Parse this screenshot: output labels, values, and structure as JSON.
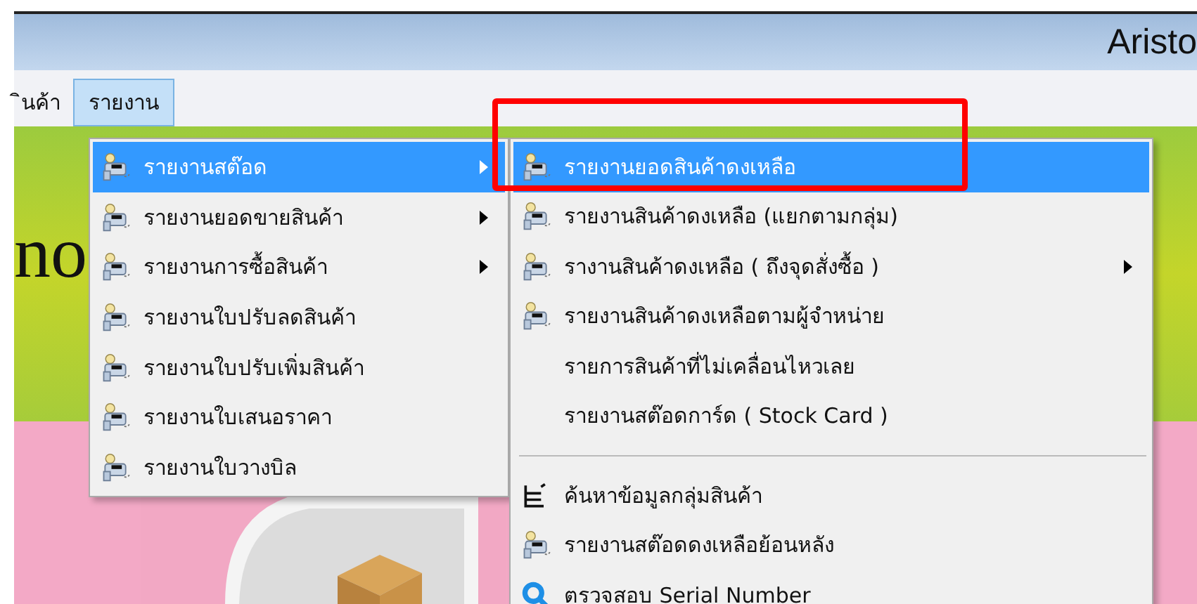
{
  "window": {
    "title": "Aristo"
  },
  "menu_bar": [
    {
      "label": "ินค้า",
      "selected": false
    },
    {
      "label": "รายงาน",
      "selected": true
    }
  ],
  "heading": "no",
  "menu": [
    {
      "kind": "report",
      "label": "รายงานสต๊อด",
      "has_submenu": true,
      "selected": true
    },
    {
      "kind": "report",
      "label": "รายงานยอดขายสินค้า",
      "has_submenu": true,
      "selected": false
    },
    {
      "kind": "report",
      "label": "รายงานการซื้อสินค้า",
      "has_submenu": true,
      "selected": false
    },
    {
      "kind": "report",
      "label": "รายงานใบปรับลดสินค้า",
      "has_submenu": false,
      "selected": false
    },
    {
      "kind": "report",
      "label": "รายงานใบปรับเพิ่มสินค้า",
      "has_submenu": false,
      "selected": false
    },
    {
      "kind": "report",
      "label": "รายงานใบเสนอราคา",
      "has_submenu": false,
      "selected": false
    },
    {
      "kind": "report",
      "label": "รายงานใบวางบิล",
      "has_submenu": false,
      "selected": false
    }
  ],
  "submenu": [
    {
      "kind": "report",
      "label": "รายงานยอดสินค้าดงเหลือ",
      "has_submenu": false,
      "selected": true
    },
    {
      "kind": "report",
      "label": "รายงานสินค้าดงเหลือ (แยกตามกลุ่ม)",
      "has_submenu": false,
      "selected": false
    },
    {
      "kind": "report",
      "label": "รางานสินค้าดงเหลือ ( ถึงจุดสั่งซื้อ )",
      "has_submenu": true,
      "selected": false
    },
    {
      "kind": "report",
      "label": "รายงานสินค้าดงเหลือตามผู้จำหน่าย",
      "has_submenu": false,
      "selected": false
    },
    {
      "kind": "plain",
      "label": "รายการสินค้าที่ไม่เคลื่อนไหวเลย",
      "has_submenu": false,
      "selected": false
    },
    {
      "kind": "plain",
      "label": "รายงานสต๊อดการ์ด ( Stock Card )",
      "has_submenu": false,
      "selected": false
    },
    {
      "kind": "separator"
    },
    {
      "kind": "list",
      "label": "ค้นหาข้อมูลกลุ่มสินค้า",
      "has_submenu": false,
      "selected": false
    },
    {
      "kind": "report",
      "label": "รายงานสต๊อดดงเหลือย้อนหลัง",
      "has_submenu": false,
      "selected": false
    },
    {
      "kind": "search",
      "label": "ตรวจสอบ Serial Number",
      "has_submenu": false,
      "selected": false
    }
  ]
}
